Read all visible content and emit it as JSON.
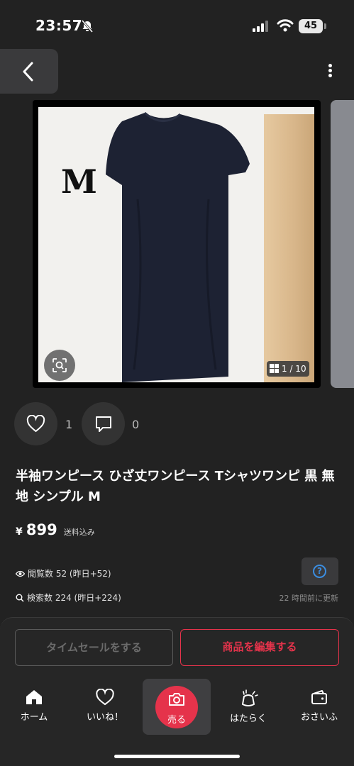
{
  "status_bar": {
    "time": "23:57",
    "battery": "45"
  },
  "image": {
    "size_overlay": "M",
    "counter": "1 / 10"
  },
  "actions": {
    "likes": "1",
    "comments": "0"
  },
  "product": {
    "title": "半袖ワンピース ひざ丈ワンピース Tシャツワンピ 黒 無地 シンプル M",
    "price_symbol": "¥",
    "price": "899",
    "price_note": "送料込み"
  },
  "stats": {
    "views": "閲覧数  52 (昨日+52)",
    "searches": "検索数  224 (昨日+224)",
    "updated": "22 時間前に更新",
    "help_symbol": "?"
  },
  "buttons": {
    "timesale": "タイムセールをする",
    "edit": "商品を編集する"
  },
  "tabs": [
    {
      "label": "ホーム",
      "icon": "home-icon"
    },
    {
      "label": "いいね！",
      "icon": "heart-icon"
    },
    {
      "label": "売る",
      "icon": "camera-icon"
    },
    {
      "label": "はたらく",
      "icon": "sparkle-bag-icon"
    },
    {
      "label": "おさいふ",
      "icon": "wallet-icon"
    }
  ],
  "colors": {
    "accent": "#e5334b",
    "background": "#222222",
    "help": "#3b8de0"
  }
}
